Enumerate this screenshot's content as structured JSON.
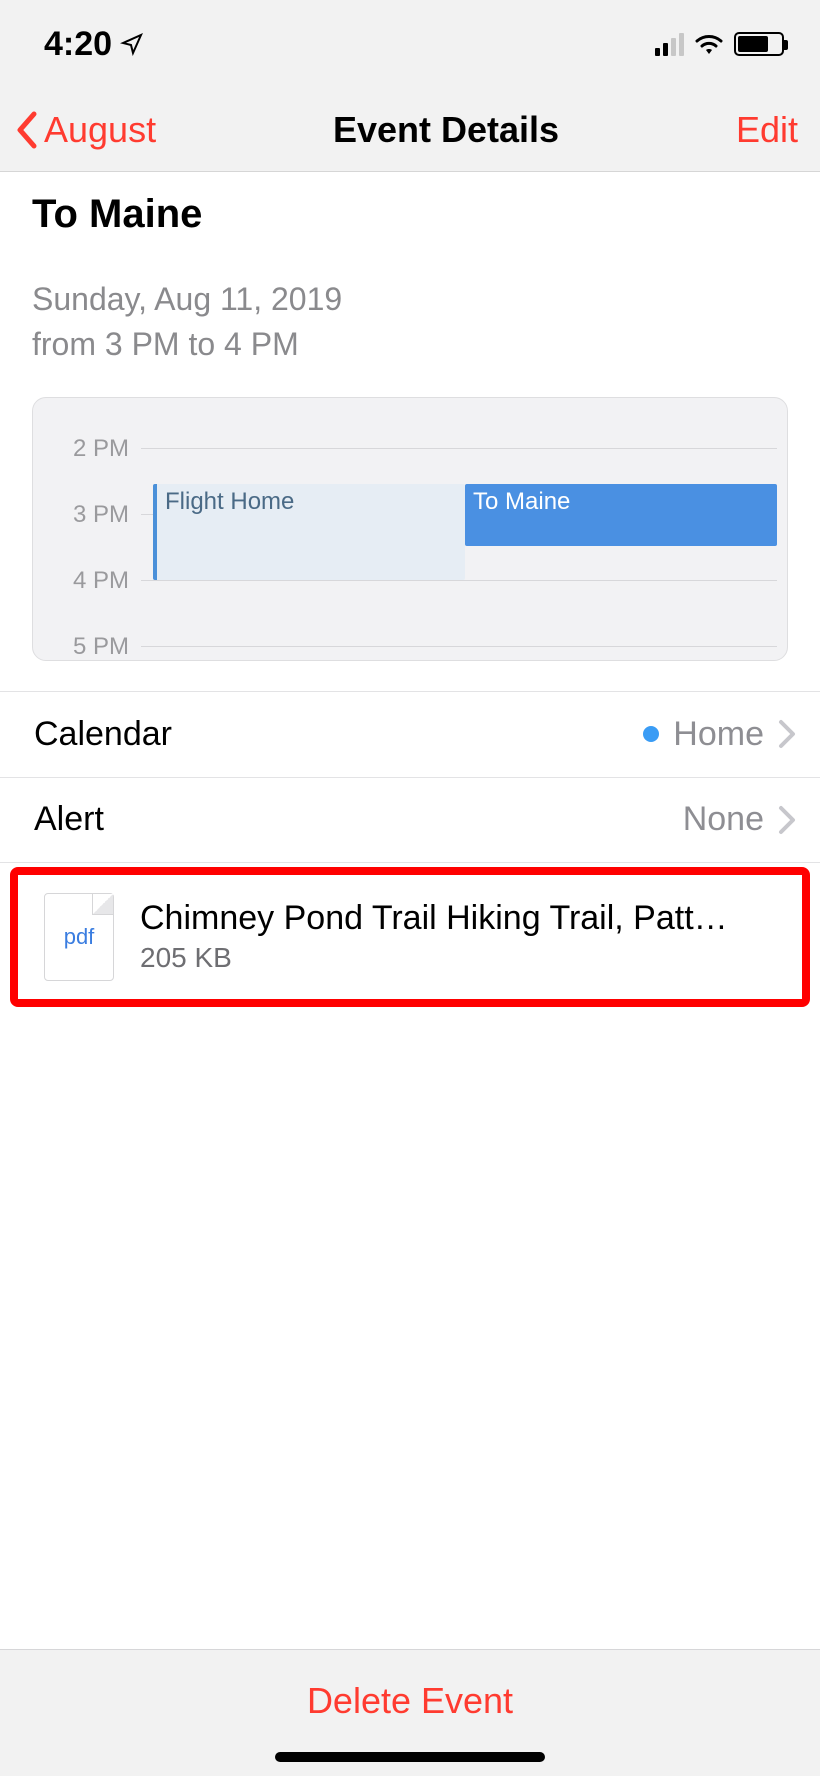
{
  "status": {
    "time": "4:20"
  },
  "nav": {
    "back_label": "August",
    "title": "Event Details",
    "edit_label": "Edit"
  },
  "event": {
    "title": "To Maine",
    "date_line": "Sunday, Aug 11, 2019",
    "time_line": "from 3 PM to 4 PM"
  },
  "timeline": {
    "hours": [
      "2 PM",
      "3 PM",
      "4 PM",
      "5 PM"
    ],
    "events": {
      "flight": "Flight Home",
      "maine": "To Maine"
    }
  },
  "rows": {
    "calendar": {
      "label": "Calendar",
      "value": "Home"
    },
    "alert": {
      "label": "Alert",
      "value": "None"
    }
  },
  "attachment": {
    "icon_label": "pdf",
    "name": "Chimney Pond Trail Hiking Trail, Patt…",
    "size": "205 KB"
  },
  "delete": {
    "label": "Delete Event"
  }
}
